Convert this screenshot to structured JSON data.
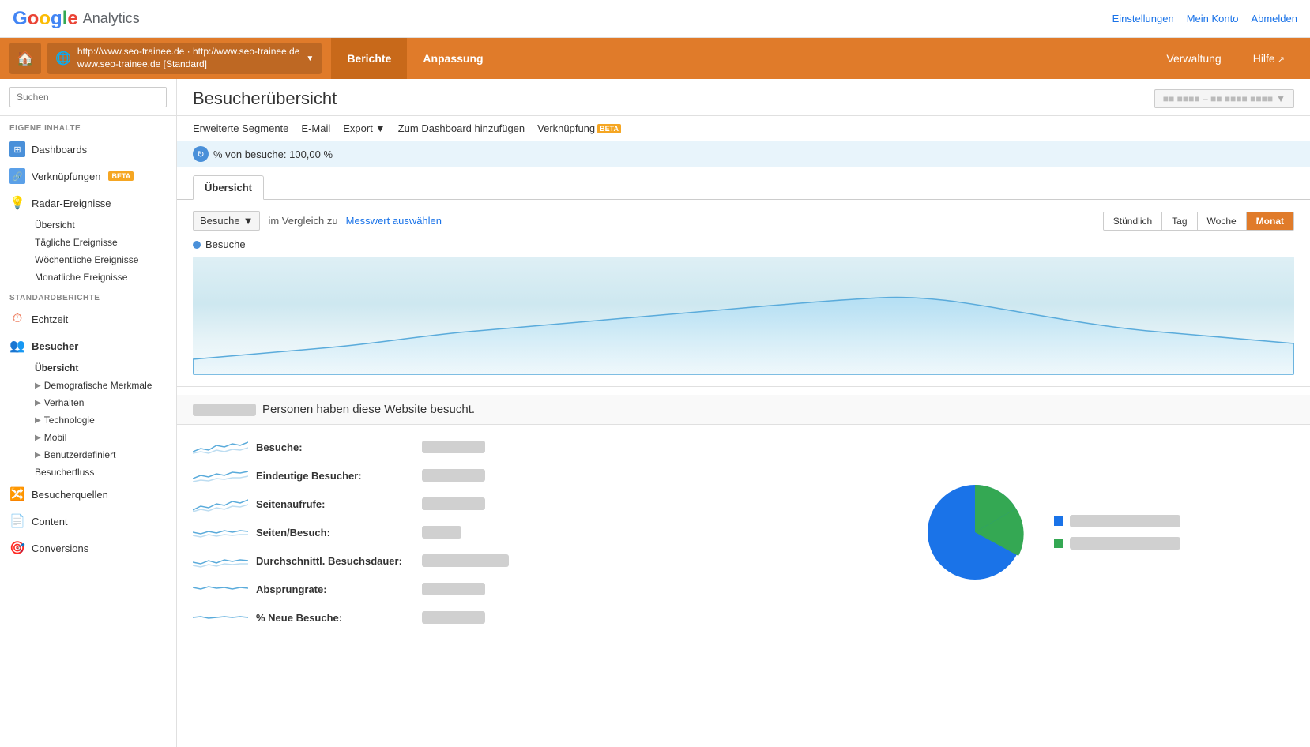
{
  "app": {
    "title": "Google Analytics",
    "logo_g": "G",
    "logo_analytics": "Analytics"
  },
  "top_nav": {
    "einstellungen": "Einstellungen",
    "mein_konto": "Mein Konto",
    "abmelden": "Abmelden"
  },
  "orange_bar": {
    "account_url1": "http://www.seo-trainee.de · http://www.seo-trainee.de",
    "account_url2": "www.seo-trainee.de [Standard]",
    "berichte": "Berichte",
    "anpassung": "Anpassung",
    "verwaltung": "Verwaltung",
    "hilfe": "Hilfe"
  },
  "sidebar": {
    "search_placeholder": "Suchen",
    "section_eigene": "EIGENE INHALTE",
    "dashboards": "Dashboards",
    "verknuepfungen": "Verknüpfungen",
    "beta": "BETA",
    "radar_ereignisse": "Radar-Ereignisse",
    "uebersicht": "Übersicht",
    "taegliche_ereignisse": "Tägliche Ereignisse",
    "woechentliche_ereignisse": "Wöchentliche Ereignisse",
    "monatliche_ereignisse": "Monatliche Ereignisse",
    "section_standard": "STANDARDBERICHTE",
    "echtzeit": "Echtzeit",
    "besucher": "Besucher",
    "besucher_uebersicht": "Übersicht",
    "demografische_merkmale": "Demografische Merkmale",
    "verhalten": "Verhalten",
    "technologie": "Technologie",
    "mobil": "Mobil",
    "benutzerdefiniert": "Benutzerdefiniert",
    "besucherfluss": "Besucherfluss",
    "besucherquellen": "Besucherquellen",
    "content": "Content",
    "conversions": "Conversions"
  },
  "toolbar": {
    "erweiterte_segmente": "Erweiterte Segmente",
    "email": "E-Mail",
    "export": "Export",
    "zum_dashboard": "Zum Dashboard hinzufügen",
    "verknuepfung": "Verknüpfung",
    "beta2": "BETA"
  },
  "segment": {
    "text": "% von besuche: 100,00 %"
  },
  "tabs": {
    "uebersicht": "Übersicht"
  },
  "chart": {
    "metric_dropdown": "Besuche",
    "vs_text": "im Vergleich zu",
    "compare_link": "Messwert auswählen",
    "time_buttons": [
      "Stündlich",
      "Tag",
      "Woche",
      "Monat"
    ],
    "active_time": "Monat",
    "legend_besuche": "Besuche"
  },
  "stats": {
    "visitors_blurred": "xxxxx",
    "headline_suffix": "Personen haben diese Website besucht.",
    "rows": [
      {
        "label": "Besuche:"
      },
      {
        "label": "Eindeutige Besucher:"
      },
      {
        "label": "Seitenaufrufe:"
      },
      {
        "label": "Seiten/Besuch:"
      },
      {
        "label": "Durchschnittl. Besuchsdauer:"
      },
      {
        "label": "Absprungrate:"
      },
      {
        "label": "% Neue Besuche:"
      }
    ]
  },
  "page": {
    "title": "Besucherübersicht"
  }
}
